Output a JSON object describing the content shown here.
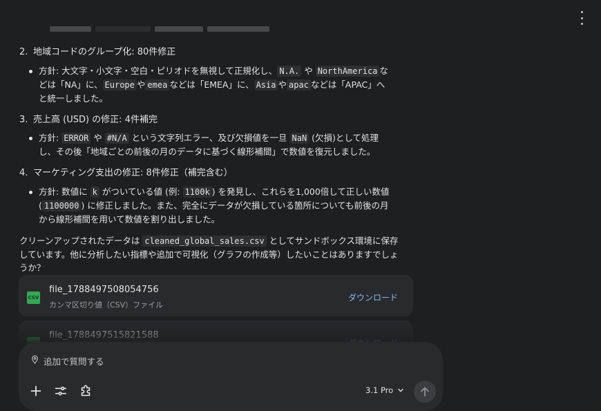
{
  "items": [
    {
      "number": "2.",
      "title": "地域コードのグループ化: 80件修正",
      "bullet_lines": [
        [
          "方針: 大文字・小文字・空白・ピリオドを無視して正規化し、",
          "N.A.",
          "や",
          "NorthAmerica",
          "な"
        ],
        [
          "どは「NA」に、",
          "Europe",
          "や",
          "emea",
          "などは「EMEA」に、",
          "Asia",
          "や",
          "apac",
          "などは「APAC」へ"
        ],
        [
          "と統一しました。"
        ]
      ]
    },
    {
      "number": "3.",
      "title": "売上高 (USD) の修正: 4件補完",
      "bullet_lines": [
        [
          "方針: ",
          "ERROR",
          " や ",
          "#N/A",
          " という文字列エラー、及び欠損値を一旦 ",
          "NaN",
          " (欠損)として処理"
        ],
        [
          "し、その後「地域ごとの前後の月のデータに基づく線形補間」で数値を復元しました。"
        ]
      ]
    },
    {
      "number": "4.",
      "title": "マーケティング支出の修正: 8件修正（補完含む）",
      "bullet_lines": [
        [
          "方針: 数値に ",
          "k",
          " がついている値 (例: ",
          "1100k",
          ") を発見し、これらを1,000倍して正しい数値"
        ],
        [
          "(",
          "1100000",
          ") に修正しました。また、完全にデータが欠損している箇所についても前後の月"
        ],
        [
          "から線形補間を用いて数値を割り出しました。"
        ]
      ]
    }
  ],
  "summary": {
    "line1_pre": "クリーンアップされたデータは ",
    "line1_code": "cleaned_global_sales.csv",
    "line1_post": " としてサンドボックス環境に保存",
    "line2": "しています。他に分析したい指標や追加で可視化（グラフの作成等）したいことはありますでしょ",
    "line3": "うか？"
  },
  "files": [
    {
      "icon": "CSV",
      "name": "file_1788497508054756",
      "type": "カンマ区切り値（CSV）ファイル",
      "download": "ダウンロード"
    },
    {
      "icon": "CSV",
      "name": "file_1788497515821588",
      "type": "",
      "download": "ダウンロード"
    }
  ],
  "composer": {
    "placeholder": "追加で質問する",
    "model": "3.1 Pro"
  }
}
